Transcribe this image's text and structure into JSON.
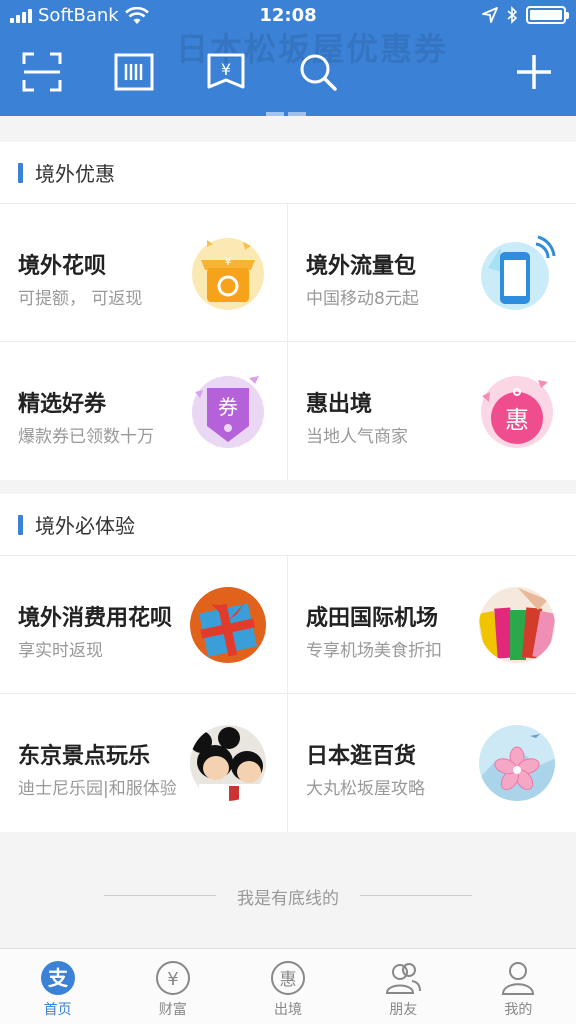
{
  "status_bar": {
    "carrier": "SoftBank",
    "time": "12:08",
    "battery_level": 1.0
  },
  "header": {
    "ghost_title": "日本松坂屋优惠券",
    "icons": [
      "scan-icon",
      "barcode-icon",
      "coupon-icon",
      "search-icon",
      "add-icon"
    ]
  },
  "sections": [
    {
      "title": "境外优惠",
      "cards": [
        {
          "title": "境外花呗",
          "subtitle": "可提额， 可返现",
          "icon": "shop-icon"
        },
        {
          "title": "境外流量包",
          "subtitle": "中国移动8元起",
          "icon": "phone-icon"
        },
        {
          "title": "精选好券",
          "subtitle": "爆款券已领数十万",
          "icon": "coupon-tag-icon",
          "icon_text": "券"
        },
        {
          "title": "惠出境",
          "subtitle": "当地人气商家",
          "icon": "hui-tag-icon",
          "icon_text": "惠"
        }
      ]
    },
    {
      "title": "境外必体验",
      "cards": [
        {
          "title": "境外消费用花呗",
          "subtitle": "享实时返现",
          "icon": "gift-photo"
        },
        {
          "title": "成田国际机场",
          "subtitle": "专享机场美食折扣",
          "icon": "shopping-bags-photo"
        },
        {
          "title": "东京景点玩乐",
          "subtitle": "迪士尼乐园|和服体验",
          "icon": "mickey-photo"
        },
        {
          "title": "日本逛百货",
          "subtitle": "大丸松坂屋攻略",
          "icon": "sakura-photo"
        }
      ]
    }
  ],
  "bottom_text": "我是有底线的",
  "tabbar": {
    "items": [
      {
        "label": "首页",
        "icon": "alipay-home-icon",
        "active": true
      },
      {
        "label": "财富",
        "icon": "wealth-icon",
        "active": false
      },
      {
        "label": "出境",
        "icon": "travel-icon",
        "active": false
      },
      {
        "label": "朋友",
        "icon": "friends-icon",
        "active": false
      },
      {
        "label": "我的",
        "icon": "profile-icon",
        "active": false
      }
    ]
  },
  "colors": {
    "brand_blue": "#3b82d6",
    "background": "#f4f4f4"
  }
}
